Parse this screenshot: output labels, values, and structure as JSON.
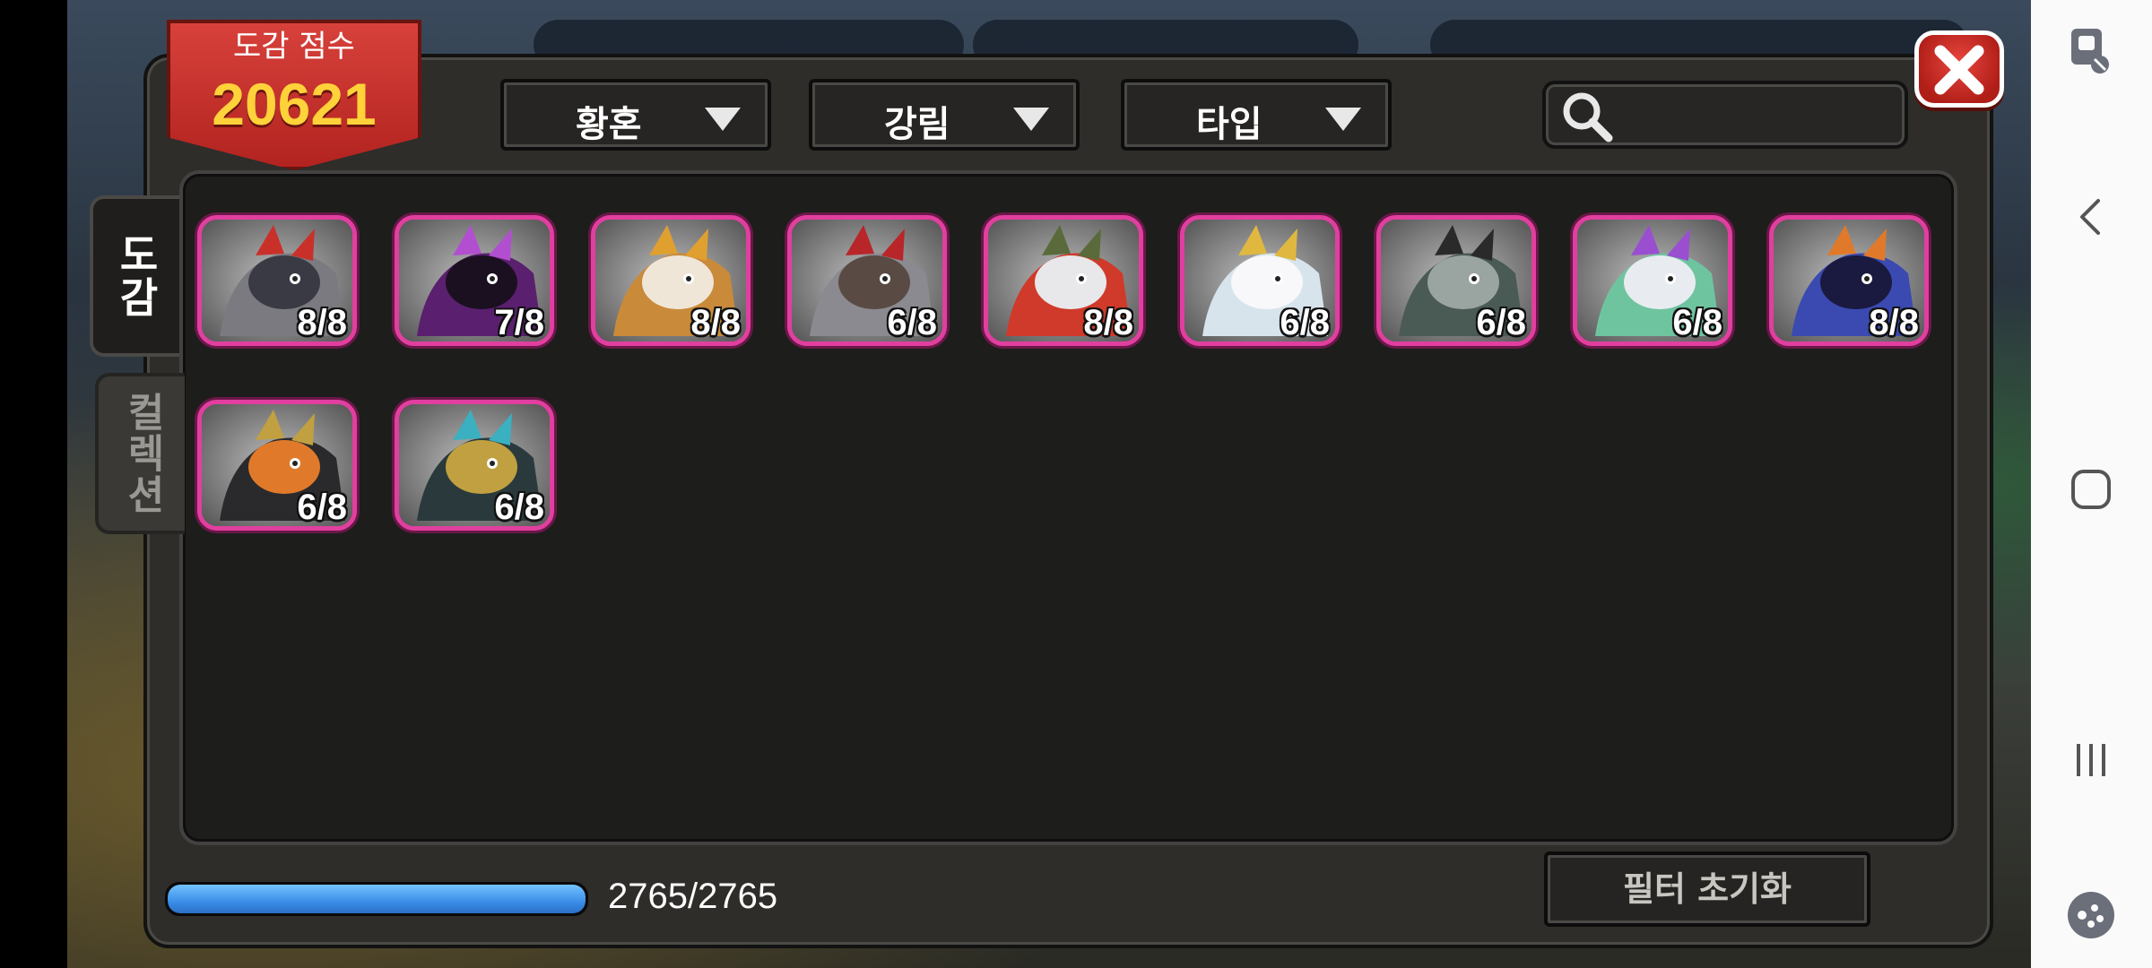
{
  "header": {
    "score_label": "도감 점수",
    "score_value": "20621"
  },
  "filters": [
    {
      "label": "황혼"
    },
    {
      "label": "강림"
    },
    {
      "label": "타입"
    }
  ],
  "search": {
    "placeholder": ""
  },
  "side_tabs": [
    {
      "label": "도감",
      "active": true
    },
    {
      "label": "컬렉션",
      "active": false
    }
  ],
  "cards": [
    {
      "count": "8/8",
      "icon": "gray-dragon-icon"
    },
    {
      "count": "7/8",
      "icon": "purple-dragon-icon"
    },
    {
      "count": "8/8",
      "icon": "golden-fox-dragon-icon"
    },
    {
      "count": "6/8",
      "icon": "red-horn-dragon-icon"
    },
    {
      "count": "8/8",
      "icon": "red-maned-beast-icon"
    },
    {
      "count": "6/8",
      "icon": "white-crowned-dragon-icon"
    },
    {
      "count": "6/8",
      "icon": "dark-horned-dragon-icon"
    },
    {
      "count": "6/8",
      "icon": "green-haired-dragon-icon"
    },
    {
      "count": "8/8",
      "icon": "blue-dragon-icon"
    },
    {
      "count": "6/8",
      "icon": "black-gold-dragon-icon"
    },
    {
      "count": "6/8",
      "icon": "armored-dragon-icon"
    }
  ],
  "progress": {
    "text": "2765/2765",
    "fraction": 1.0
  },
  "reset_button": {
    "label": "필터 초기화"
  },
  "colors": {
    "card_border": "#e13fa0",
    "score_badge": "#c3302a",
    "score_value": "#ffd23a",
    "progress_fill": "#3a8ee8"
  }
}
